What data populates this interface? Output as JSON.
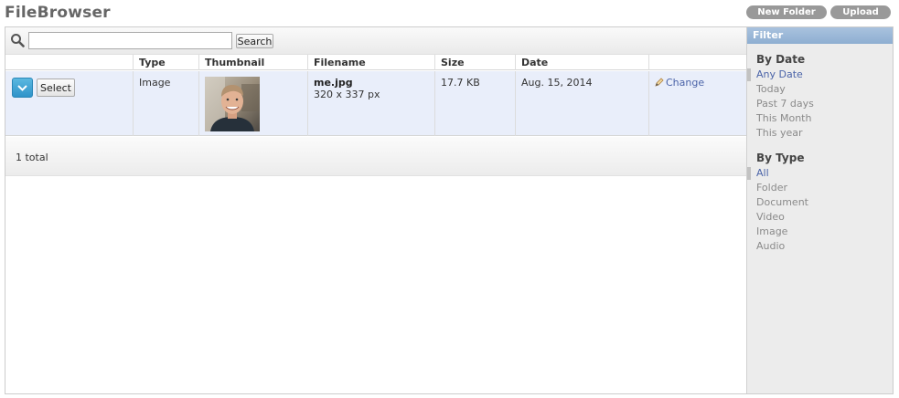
{
  "app": {
    "title": "FileBrowser"
  },
  "header_buttons": {
    "new_folder": "New Folder",
    "upload": "Upload"
  },
  "search": {
    "value": "",
    "placeholder": "",
    "button": "Search"
  },
  "table": {
    "columns": [
      "",
      "Type",
      "Thumbnail",
      "Filename",
      "Size",
      "Date",
      ""
    ],
    "rows": [
      {
        "select_label": "Select",
        "type": "Image",
        "filename": "me.jpg",
        "dimensions": "320 x 337 px",
        "size": "17.7 KB",
        "date": "Aug. 15, 2014",
        "action": "Change"
      }
    ],
    "total": "1 total"
  },
  "filter": {
    "title": "Filter",
    "by_date": {
      "title": "By Date",
      "items": [
        "Any Date",
        "Today",
        "Past 7 days",
        "This Month",
        "This year"
      ],
      "active": "Any Date"
    },
    "by_type": {
      "title": "By Type",
      "items": [
        "All",
        "Folder",
        "Document",
        "Video",
        "Image",
        "Audio"
      ],
      "active": "All"
    }
  },
  "colors": {
    "accent": "#2f93c9",
    "link": "#4a63a8",
    "row_highlight": "#e9eefa",
    "filter_header": "#8eaed1"
  },
  "icons": {
    "search": "search-icon",
    "dropdown": "chevron-down-icon",
    "edit": "pencil-icon"
  }
}
